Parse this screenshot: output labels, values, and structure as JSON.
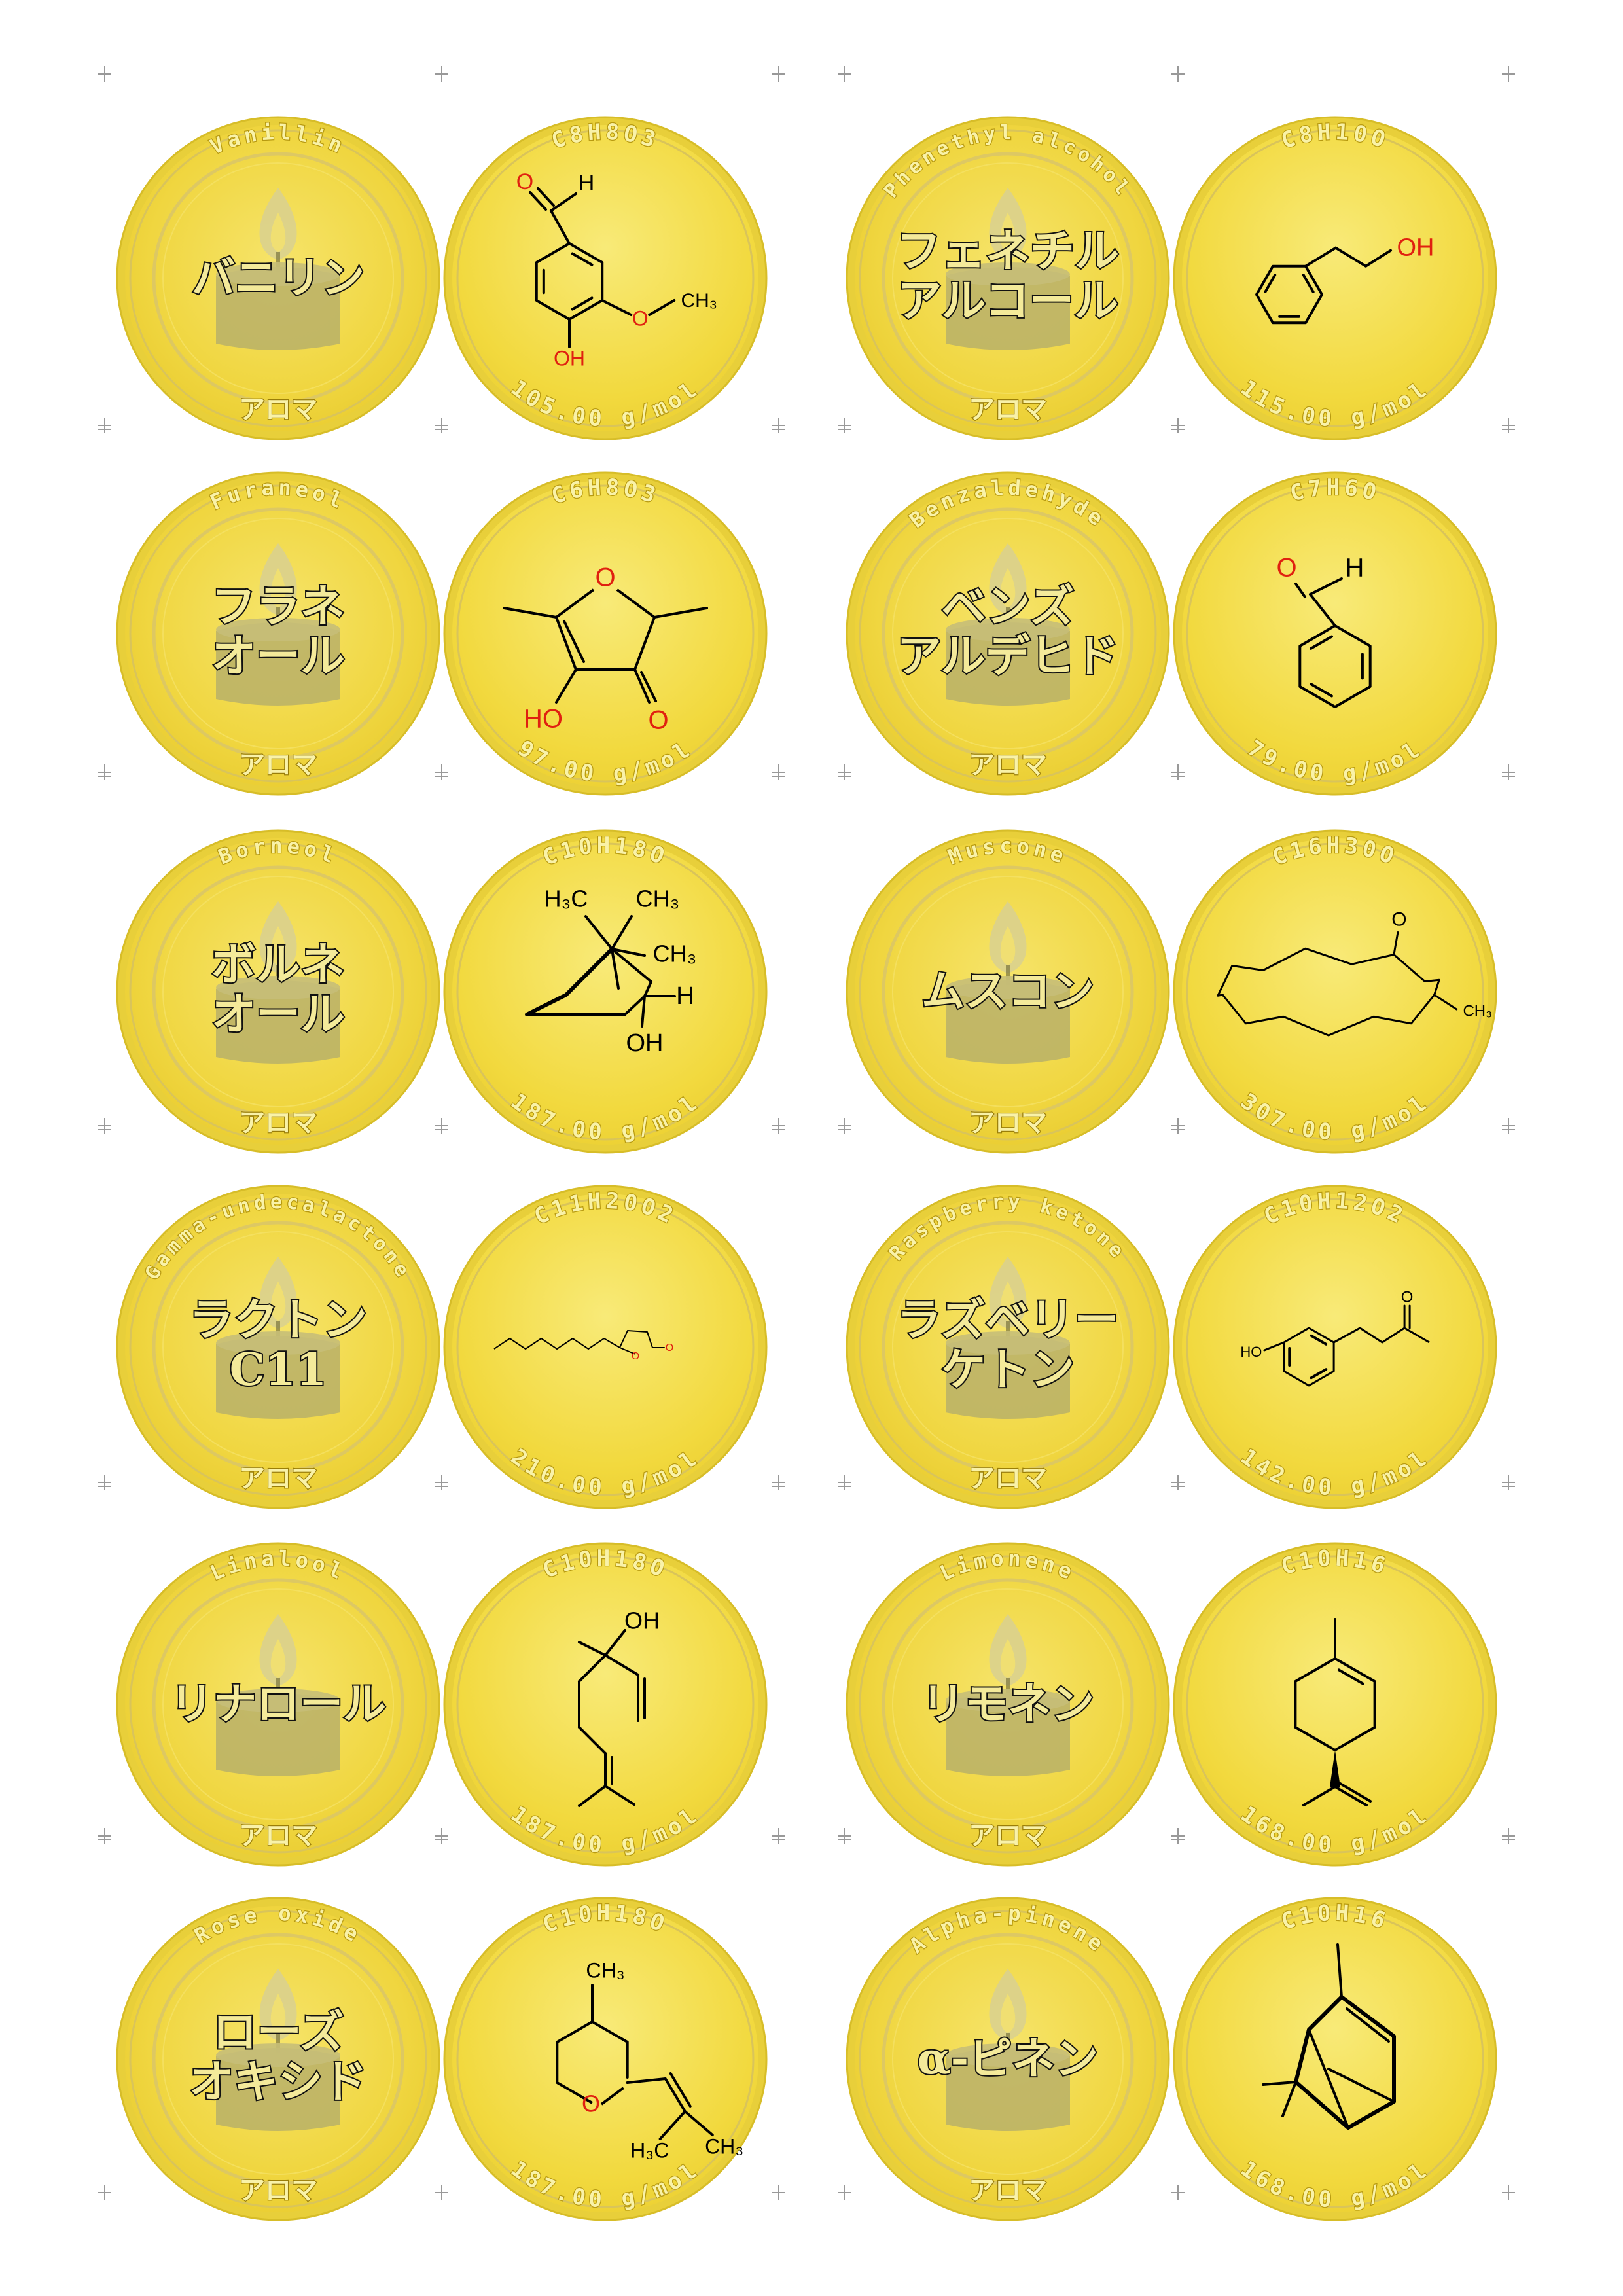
{
  "footer_label": "アロマ",
  "colors": {
    "coin_outer": "#f7e96a",
    "coin_inner": "#f2da3c",
    "ring": "#d9c45a",
    "candle": "#b8b068",
    "flame": "#d8d090",
    "arc_text": "#f9f2a8",
    "oxygen": "#e02010"
  },
  "pairs": [
    {
      "en": "Vanillin",
      "jp": [
        "バニリン"
      ],
      "formula": "C8H8O3",
      "mass": "105.00 g/mol",
      "mol": "vanillin"
    },
    {
      "en": "Phenethyl alcohol",
      "jp": [
        "フェネチル",
        "アルコール"
      ],
      "formula": "C8H10O",
      "mass": "115.00 g/mol",
      "mol": "phenethyl"
    },
    {
      "en": "Furaneol",
      "jp": [
        "フラネ",
        "オール"
      ],
      "formula": "C6H8O3",
      "mass": "97.00 g/mol",
      "mol": "furaneol"
    },
    {
      "en": "Benzaldehyde",
      "jp": [
        "ベンズ",
        "アルデヒド"
      ],
      "formula": "C7H6O",
      "mass": "79.00 g/mol",
      "mol": "benzaldehyde"
    },
    {
      "en": "Borneol",
      "jp": [
        "ボルネ",
        "オール"
      ],
      "formula": "C10H18O",
      "mass": "187.00 g/mol",
      "mol": "borneol"
    },
    {
      "en": "Muscone",
      "jp": [
        "ムスコン"
      ],
      "formula": "C16H30O",
      "mass": "307.00 g/mol",
      "mol": "muscone"
    },
    {
      "en": "Gamma-undecalactone",
      "jp": [
        "ラクトン",
        "C11"
      ],
      "formula": "C11H20O2",
      "mass": "210.00 g/mol",
      "mol": "lactone"
    },
    {
      "en": "Raspberry ketone",
      "jp": [
        "ラズベリー",
        "ケトン"
      ],
      "formula": "C10H12O2",
      "mass": "142.00 g/mol",
      "mol": "raspberry"
    },
    {
      "en": "Linalool",
      "jp": [
        "リナロール"
      ],
      "formula": "C10H18O",
      "mass": "187.00 g/mol",
      "mol": "linalool"
    },
    {
      "en": "Limonene",
      "jp": [
        "リモネン"
      ],
      "formula": "C10H16",
      "mass": "168.00 g/mol",
      "mol": "limonene"
    },
    {
      "en": "Rose oxide",
      "jp": [
        "ローズ",
        "オキシド"
      ],
      "formula": "C10H18O",
      "mass": "187.00 g/mol",
      "mol": "roseoxide"
    },
    {
      "en": "Alpha-pinene",
      "jp": [
        "α-ピネン"
      ],
      "formula": "C10H16",
      "mass": "168.00 g/mol",
      "mol": "pinene"
    }
  ],
  "atom_labels": {
    "O": "O",
    "H": "H",
    "OH": "OH",
    "HO": "HO",
    "CH3": "CH₃",
    "H3C": "H₃C"
  }
}
